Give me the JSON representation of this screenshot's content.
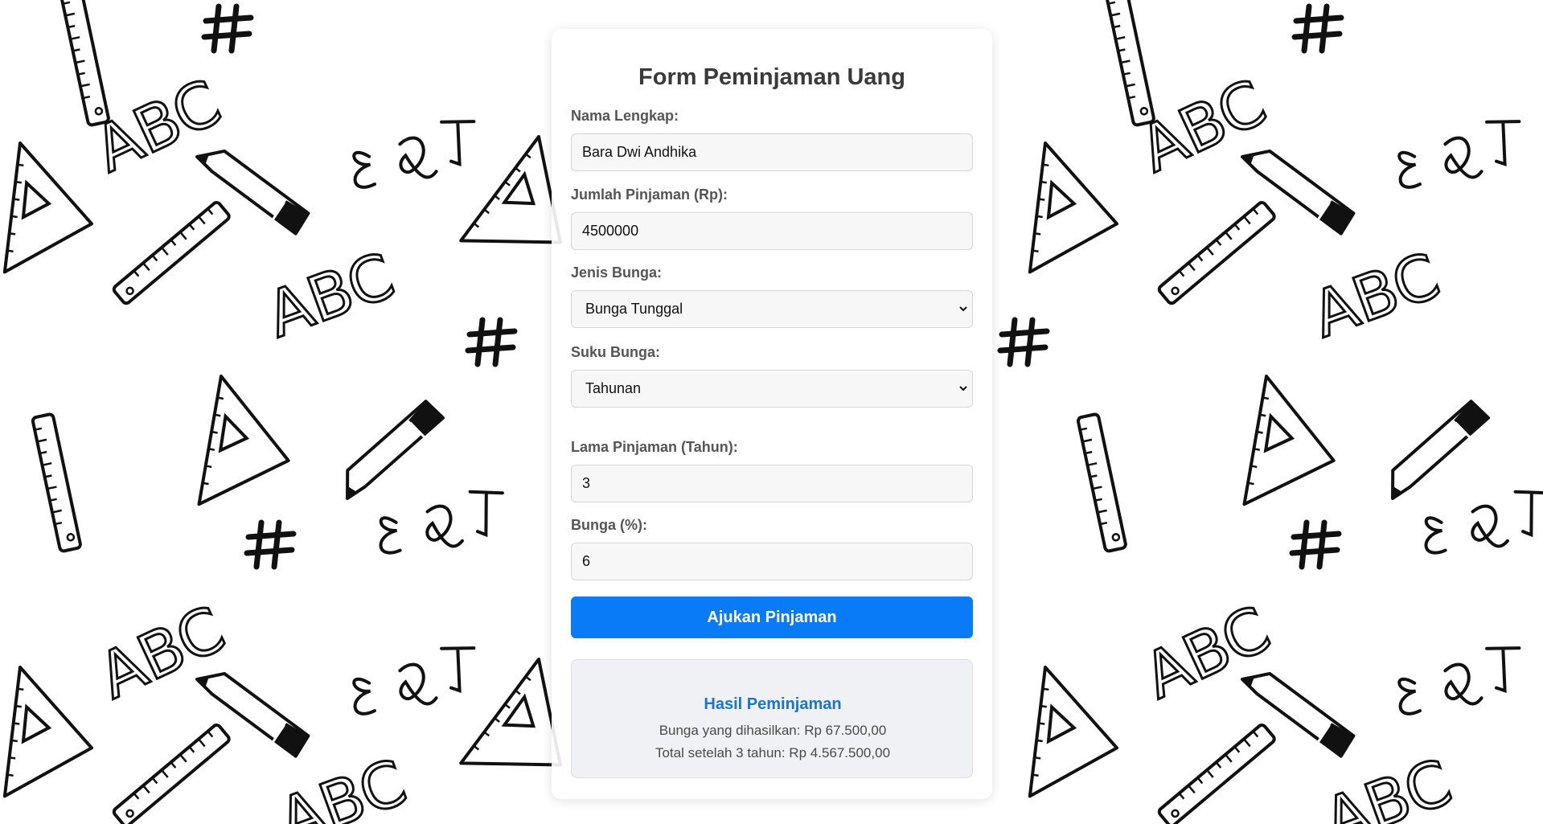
{
  "form": {
    "title": "Form Peminjaman Uang",
    "nama_label": "Nama Lengkap:",
    "nama_value": "Bara Dwi Andhika",
    "jumlah_label": "Jumlah Pinjaman (Rp):",
    "jumlah_value": "4500000",
    "jenis_label": "Jenis Bunga:",
    "jenis_value": "Bunga Tunggal",
    "suku_label": "Suku Bunga:",
    "suku_value": "Tahunan",
    "lama_label": "Lama Pinjaman (Tahun):",
    "lama_value": "3",
    "bunga_label": "Bunga (%):",
    "bunga_value": "6",
    "submit_label": "Ajukan Pinjaman"
  },
  "result": {
    "title": "Hasil Peminjaman",
    "interest_line": "Bunga yang dihasilkan: Rp 67.500,00",
    "total_line": "Total setelah 3 tahun: Rp 4.567.500,00"
  },
  "colors": {
    "accent": "#0a7bf7",
    "result_title": "#1a73d9",
    "doodle": "#111111"
  }
}
